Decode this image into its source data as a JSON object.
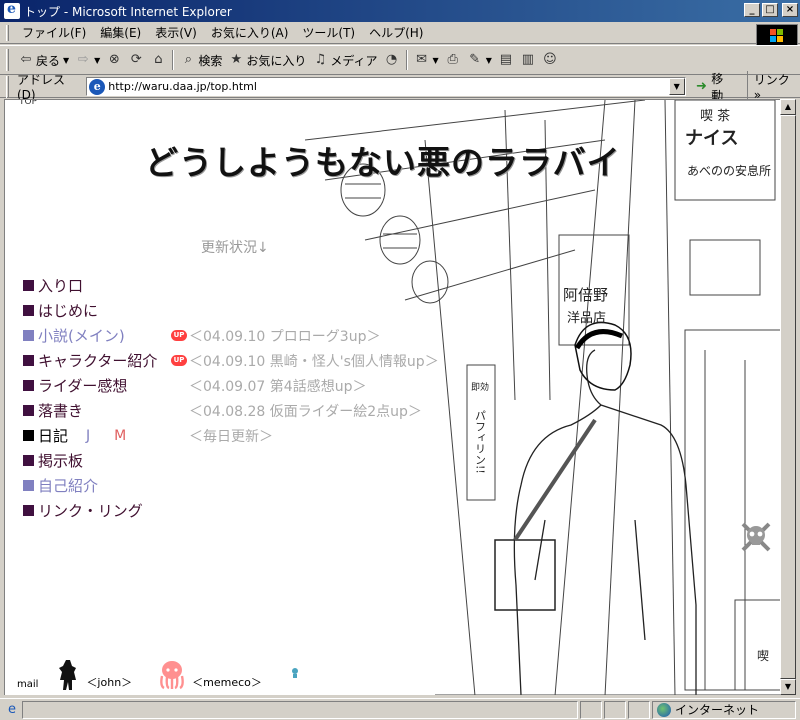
{
  "window": {
    "title": "トップ - Microsoft Internet Explorer",
    "controls": {
      "minimize": "_",
      "maximize": "□",
      "close": "×"
    }
  },
  "menu": [
    "ファイル(F)",
    "編集(E)",
    "表示(V)",
    "お気に入り(A)",
    "ツール(T)",
    "ヘルプ(H)"
  ],
  "toolbar": {
    "back": "戻る",
    "search": "検索",
    "favorites": "お気に入り",
    "media": "メディア"
  },
  "address": {
    "label": "アドレス(D)",
    "url": "http://waru.daa.jp/top.html",
    "go": "移動",
    "links": "リンク"
  },
  "page": {
    "corner_text": "TOP",
    "title": "どうしようもない悪のララバイ",
    "updates_heading": "更新状況↓",
    "nav": [
      {
        "label": "入り口",
        "square": "#401040",
        "style": "normal"
      },
      {
        "label": "はじめに",
        "square": "#401040",
        "style": "normal"
      },
      {
        "label": "小説(メイン)",
        "square": "#8080c0",
        "style": "light"
      },
      {
        "label": "キャラクター紹介",
        "square": "#401040",
        "style": "normal"
      },
      {
        "label": "ライダー感想",
        "square": "#401040",
        "style": "normal"
      },
      {
        "label": "落書き",
        "square": "#401040",
        "style": "normal"
      },
      {
        "label": "日記",
        "square": "#000000",
        "style": "dark",
        "extra_j": "J",
        "extra_m": "M"
      },
      {
        "label": "掲示板",
        "square": "#401040",
        "style": "normal"
      },
      {
        "label": "自己紹介",
        "square": "#8080c0",
        "style": "light"
      },
      {
        "label": "リンク・リング",
        "square": "#401040",
        "style": "normal"
      }
    ],
    "updates": [
      {
        "text": "",
        "badge": ""
      },
      {
        "text": "",
        "badge": ""
      },
      {
        "text": "＜04.09.10 プロローグ3up＞",
        "badge": "UP"
      },
      {
        "text": "＜04.09.10 黒崎・怪人's個人情報up＞",
        "badge": "UP"
      },
      {
        "text": "＜04.09.07 第4話感想up＞",
        "badge": ""
      },
      {
        "text": "＜04.08.28 仮面ライダー絵2点up＞",
        "badge": ""
      },
      {
        "text": "＜毎日更新＞",
        "badge": ""
      }
    ],
    "footer": {
      "mail": "mail",
      "john": "＜john＞",
      "memeco": "＜memeco＞"
    },
    "illustration_signs": [
      "喫 茶",
      "ナイス",
      "あべのの安息所",
      "阿倍野",
      "洋品店",
      "即効",
      "パフィリン!!",
      "喫"
    ]
  },
  "status": {
    "zone": "インターネット"
  },
  "colors": {
    "title_bar": "#0a246a",
    "nav_dark_purple": "#401040",
    "nav_light": "#8080c0",
    "update_text": "#aaaaaa",
    "up_badge": "#ff4040",
    "memeco_pink": "#ff9090"
  }
}
